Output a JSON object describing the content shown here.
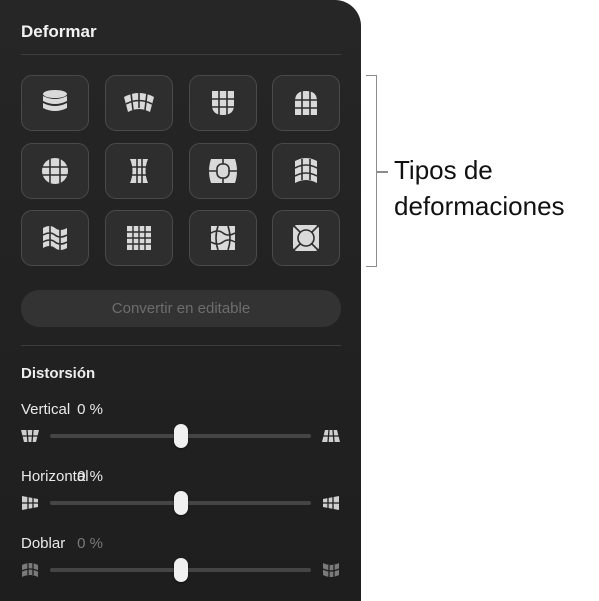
{
  "panel": {
    "title": "Deformar",
    "warp_types": [
      {
        "icon": "cylinder-warp-icon"
      },
      {
        "icon": "arc-warp-icon"
      },
      {
        "icon": "bowl-warp-icon"
      },
      {
        "icon": "arch-warp-icon"
      },
      {
        "icon": "sphere-warp-icon"
      },
      {
        "icon": "pinch-warp-icon"
      },
      {
        "icon": "bulge-warp-icon"
      },
      {
        "icon": "flag-left-warp-icon"
      },
      {
        "icon": "wave-warp-icon"
      },
      {
        "icon": "grid-warp-icon"
      },
      {
        "icon": "twist-warp-icon"
      },
      {
        "icon": "fisheye-warp-icon"
      }
    ],
    "convert_label": "Convertir en editable",
    "distortion_title": "Distorsión",
    "sliders": [
      {
        "label": "Vertical",
        "value": "0 %",
        "level": 0.5
      },
      {
        "label": "Horizontal",
        "value": "0 %",
        "level": 0.5
      },
      {
        "label": "Doblar",
        "value": "0 %",
        "level": 0.5
      }
    ]
  },
  "callout": {
    "line1": "Tipos de",
    "line2": "deformaciones"
  }
}
